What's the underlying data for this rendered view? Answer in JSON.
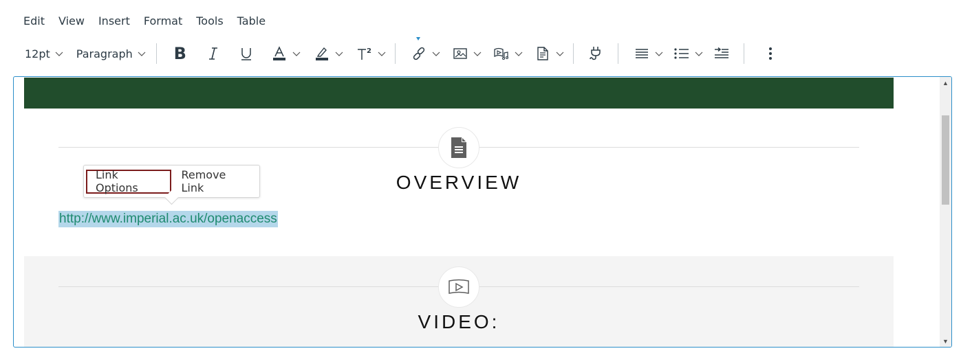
{
  "menubar": {
    "items": [
      "Edit",
      "View",
      "Insert",
      "Format",
      "Tools",
      "Table"
    ]
  },
  "toolbar": {
    "font_size": "12pt",
    "block_format": "Paragraph",
    "buttons": {
      "bold": "bold-icon",
      "italic": "italic-icon",
      "underline": "underline-icon",
      "text_color": "text-color-icon",
      "highlight": "highlight-icon",
      "superscript": "superscript-icon",
      "link": "link-icon",
      "image": "image-icon",
      "media": "media-icon",
      "document": "document-icon",
      "plugin": "plug-icon",
      "align": "align-icon",
      "list": "list-icon",
      "indent": "indent-icon",
      "more": "more-vertical-icon"
    }
  },
  "editor": {
    "banner_color": "#214d2c",
    "sections": [
      {
        "heading": "OVERVIEW",
        "icon": "document-icon"
      },
      {
        "heading": "VIDEO:",
        "icon": "video-icon"
      }
    ],
    "link_text": "http://www.imperial.ac.uk/openaccess",
    "link_popup": {
      "options_label": "Link Options",
      "remove_label": "Remove Link"
    }
  },
  "colors": {
    "accent": "#2b8ec9",
    "link": "#1f8a70",
    "selection": "#b4d7ea",
    "focus_ring": "#7b1c1c"
  }
}
